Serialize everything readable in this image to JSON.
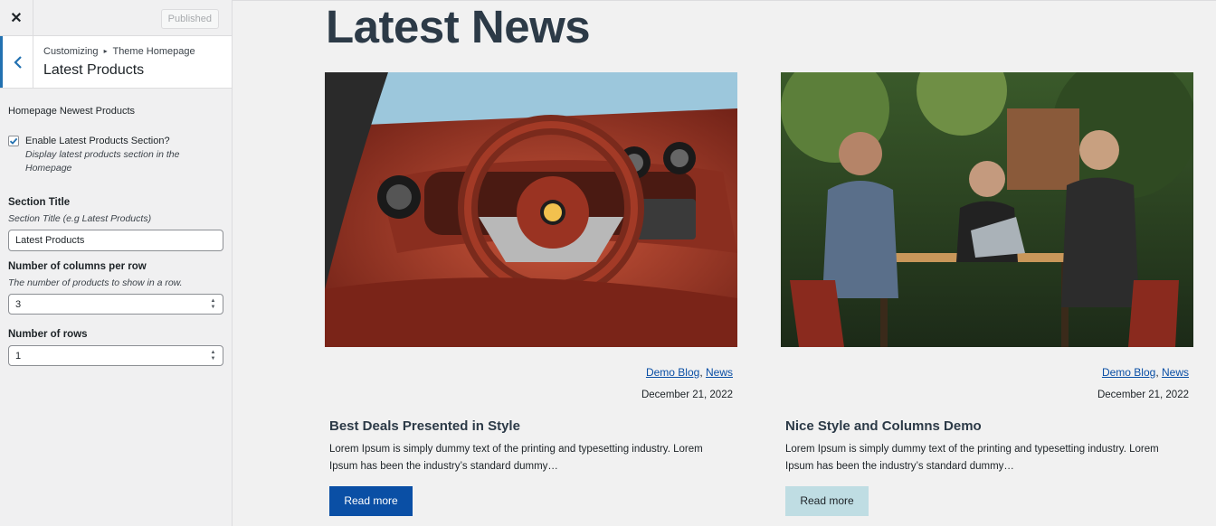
{
  "customizer": {
    "close_icon": "close-icon",
    "publish_label": "Published",
    "breadcrumb_parent": "Customizing",
    "breadcrumb_separator": "▸",
    "breadcrumb_section": "Theme Homepage",
    "section_title": "Latest Products",
    "group_title": "Homepage Newest Products",
    "enable": {
      "checked": true,
      "label": "Enable Latest Products Section?",
      "description": "Display latest products section in the Homepage"
    },
    "title_field": {
      "label": "Section Title",
      "description": "Section Title (e.g Latest Products)",
      "value": "Latest Products"
    },
    "columns_field": {
      "label": "Number of columns per row",
      "description": "The number of products to show in a row.",
      "value": "3"
    },
    "rows_field": {
      "label": "Number of rows",
      "value": "1"
    },
    "accent": "#2271b1"
  },
  "preview": {
    "heading": "Latest News",
    "posts": [
      {
        "categories": [
          "Demo Blog",
          "News"
        ],
        "date": "December 21, 2022",
        "title": "Best Deals Presented in Style",
        "excerpt": "Lorem Ipsum is simply dummy text of the printing and typesetting industry. Lorem Ipsum has been the industry’s standard dummy…",
        "button": "Read more",
        "button_color": "#0a4fa5"
      },
      {
        "categories": [
          "Demo Blog",
          "News"
        ],
        "date": "December 21, 2022",
        "title": "Nice Style and Columns Demo",
        "excerpt": "Lorem Ipsum is simply dummy text of the printing and typesetting industry. Lorem Ipsum has been the industry’s standard dummy…",
        "button": "Read more",
        "button_color": "#bfdde3"
      }
    ]
  }
}
